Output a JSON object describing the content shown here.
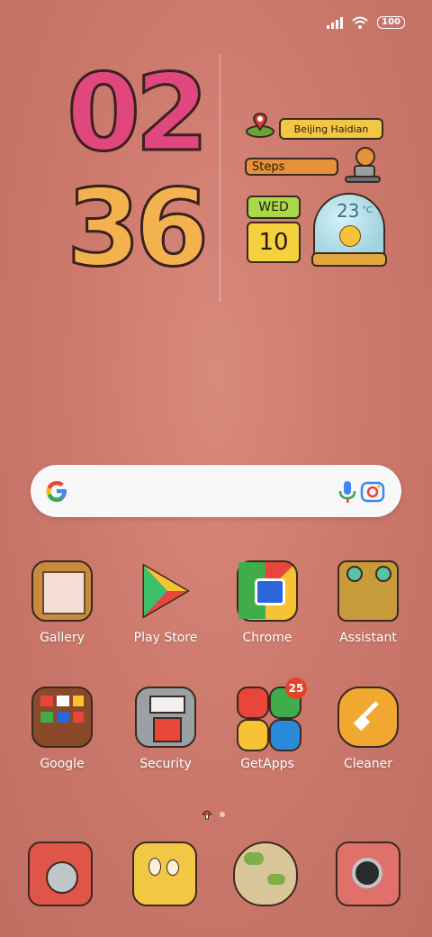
{
  "status": {
    "battery": "100"
  },
  "clock": {
    "hour": "02",
    "minute": "36"
  },
  "widget": {
    "location": "Beijing Haidian",
    "steps_label": "Steps",
    "weekday": "WED",
    "day": "10",
    "temperature": "23",
    "temp_unit": "°C"
  },
  "apps_row1": [
    {
      "label": "Gallery"
    },
    {
      "label": "Play Store"
    },
    {
      "label": "Chrome"
    },
    {
      "label": "Assistant"
    }
  ],
  "apps_row2": [
    {
      "label": "Google"
    },
    {
      "label": "Security"
    },
    {
      "label": "GetApps",
      "badge": "25"
    },
    {
      "label": "Cleaner"
    }
  ],
  "colors": {
    "bg": "#cd7a6d",
    "accent_yellow": "#f2c744",
    "accent_orange": "#e5923a",
    "accent_green": "#a9d84a"
  }
}
